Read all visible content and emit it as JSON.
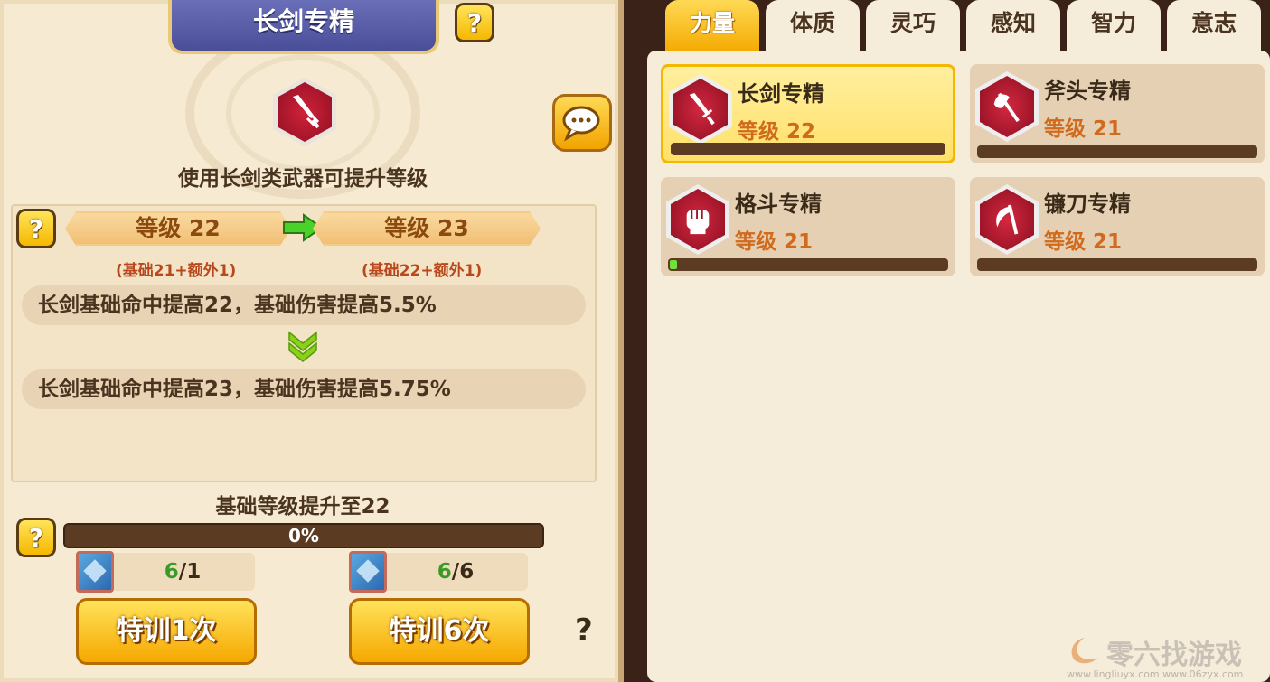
{
  "left": {
    "title": "长剑专精",
    "description": "使用长剑类武器可提升等级",
    "current_level": "等级 22",
    "next_level": "等级 23",
    "current_base": "(基础21+额外1)",
    "next_base": "(基础22+额外1)",
    "current_effect": "长剑基础命中提高22，基础伤害提高5.5%",
    "next_effect": "长剑基础命中提高23，基础伤害提高5.75%",
    "base_level_title": "基础等级提升至22",
    "progress_label": "0%",
    "progress_value": 0,
    "item1": {
      "have": "6",
      "need": "/1"
    },
    "item2": {
      "have": "6",
      "need": "/6"
    },
    "train1_label": "特训1次",
    "train6_label": "特训6次",
    "help_glyph": "?",
    "bottom_help": "?"
  },
  "tabs": [
    {
      "label": "力量",
      "active": true
    },
    {
      "label": "体质",
      "active": false
    },
    {
      "label": "灵巧",
      "active": false
    },
    {
      "label": "感知",
      "active": false
    },
    {
      "label": "智力",
      "active": false
    },
    {
      "label": "意志",
      "active": false
    }
  ],
  "skills": [
    {
      "name": "长剑专精",
      "level": "等级 22",
      "progress": 0,
      "selected": true,
      "icon": "sword-icon"
    },
    {
      "name": "斧头专精",
      "level": "等级 21",
      "progress": 0,
      "selected": false,
      "icon": "axe-icon"
    },
    {
      "name": "格斗专精",
      "level": "等级 21",
      "progress": 0.02,
      "selected": false,
      "icon": "fist-icon"
    },
    {
      "name": "镰刀专精",
      "level": "等级 21",
      "progress": 0,
      "selected": false,
      "icon": "scythe-icon"
    }
  ],
  "watermark": {
    "brand": "零六找游戏",
    "urls": "www.lingliuyx.com   www.06zyx.com"
  },
  "colors": {
    "accent_yellow": "#f5b800",
    "banner_purple": "#5a5ea8",
    "level_orange": "#d06a1c",
    "progress_green": "#6fe23a"
  }
}
